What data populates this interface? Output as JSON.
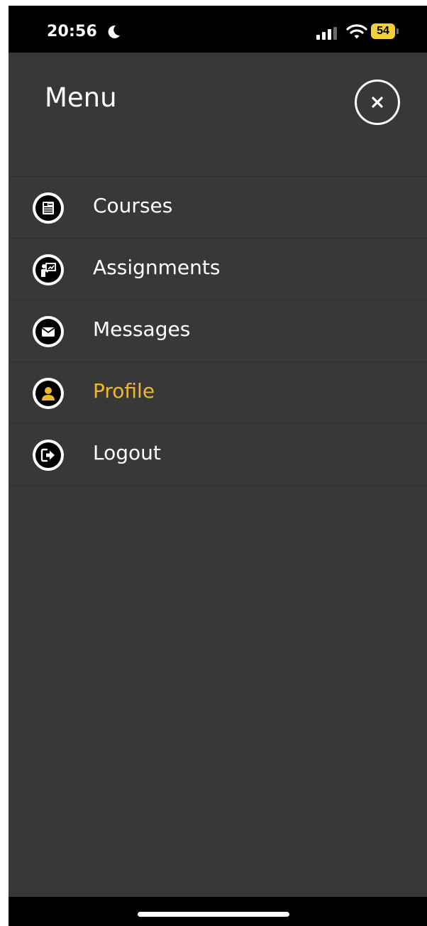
{
  "status_bar": {
    "time": "20:56",
    "battery_level": "54",
    "icons": [
      "moon-icon",
      "signal-icon",
      "wifi-icon",
      "battery-icon"
    ]
  },
  "header": {
    "title": "Menu",
    "close_icon": "close-icon"
  },
  "menu": {
    "items": [
      {
        "label": "Courses",
        "icon": "courses-icon",
        "active": false
      },
      {
        "label": "Assignments",
        "icon": "assignments-icon",
        "active": false
      },
      {
        "label": "Messages",
        "icon": "messages-icon",
        "active": false
      },
      {
        "label": "Profile",
        "icon": "profile-icon",
        "active": true
      },
      {
        "label": "Logout",
        "icon": "logout-icon",
        "active": false
      }
    ]
  },
  "colors": {
    "background": "#383838",
    "active": "#efb82c",
    "text": "#ffffff",
    "battery": "#f1cf3b"
  }
}
